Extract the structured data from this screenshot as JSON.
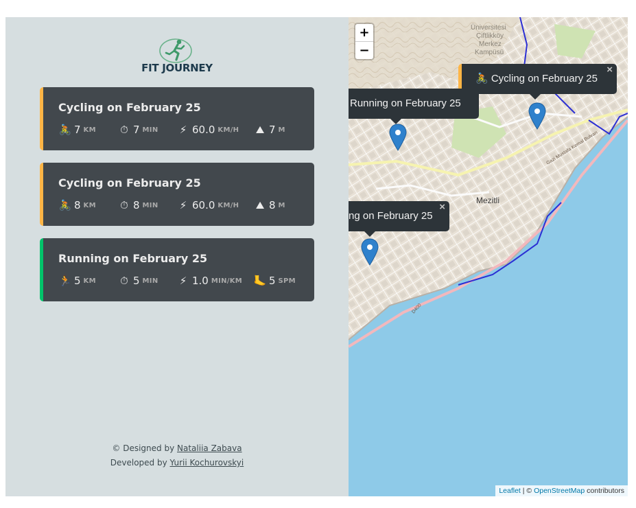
{
  "app": {
    "logo_text": "FIT JOURNEY"
  },
  "workouts": [
    {
      "type": "cycling",
      "title": "Cycling on February 25",
      "accent": "#ffb545",
      "details": [
        {
          "icon": "bicycle-icon",
          "glyph": "🚴",
          "value": "7",
          "unit": "KM"
        },
        {
          "icon": "stopwatch-icon",
          "glyph": "⏱",
          "value": "7",
          "unit": "MIN"
        },
        {
          "icon": "lightning-icon",
          "glyph": "⚡",
          "value": "60.0",
          "unit": "KM/H"
        },
        {
          "icon": "mountain-icon",
          "glyph": "⛰",
          "value": "7",
          "unit": "M"
        }
      ]
    },
    {
      "type": "cycling",
      "title": "Cycling on February 25",
      "accent": "#ffb545",
      "details": [
        {
          "icon": "bicycle-icon",
          "glyph": "🚴",
          "value": "8",
          "unit": "KM"
        },
        {
          "icon": "stopwatch-icon",
          "glyph": "⏱",
          "value": "8",
          "unit": "MIN"
        },
        {
          "icon": "lightning-icon",
          "glyph": "⚡",
          "value": "60.0",
          "unit": "KM/H"
        },
        {
          "icon": "mountain-icon",
          "glyph": "⛰",
          "value": "8",
          "unit": "M"
        }
      ]
    },
    {
      "type": "running",
      "title": "Running on February 25",
      "accent": "#00c46a",
      "details": [
        {
          "icon": "runner-icon",
          "glyph": "🏃",
          "value": "5",
          "unit": "KM"
        },
        {
          "icon": "stopwatch-icon",
          "glyph": "⏱",
          "value": "5",
          "unit": "MIN"
        },
        {
          "icon": "lightning-icon",
          "glyph": "⚡",
          "value": "1.0",
          "unit": "MIN/KM"
        },
        {
          "icon": "foot-icon",
          "glyph": "🦶",
          "value": "5",
          "unit": "SPM"
        }
      ]
    }
  ],
  "footer": {
    "designed_prefix": "© Designed by",
    "designer": "Nataliia Zabava",
    "developed_prefix": "Developed by",
    "developer": "Yurii Kochurovskyi"
  },
  "map": {
    "zoom_in": "+",
    "zoom_out": "−",
    "labels": {
      "campus_1": "Üniversitesi",
      "campus_2": "Çiftlikköy",
      "campus_3": "Merkez",
      "campus_4": "Kampüsü",
      "district": "Mezitli",
      "boulevard": "Gazi Mustafa Kemal Bulvarı",
      "road": "D400"
    },
    "popups": [
      {
        "text": "🚴 Cycling on February 25",
        "accent": "#ffb545",
        "close": "×"
      },
      {
        "text": "Running on February 25"
      },
      {
        "text": "ng on February 25",
        "close": "×"
      }
    ],
    "attribution": {
      "leaflet": "Leaflet",
      "sep": " | © ",
      "osm": "OpenStreetMap",
      "tail": " contributors"
    }
  }
}
